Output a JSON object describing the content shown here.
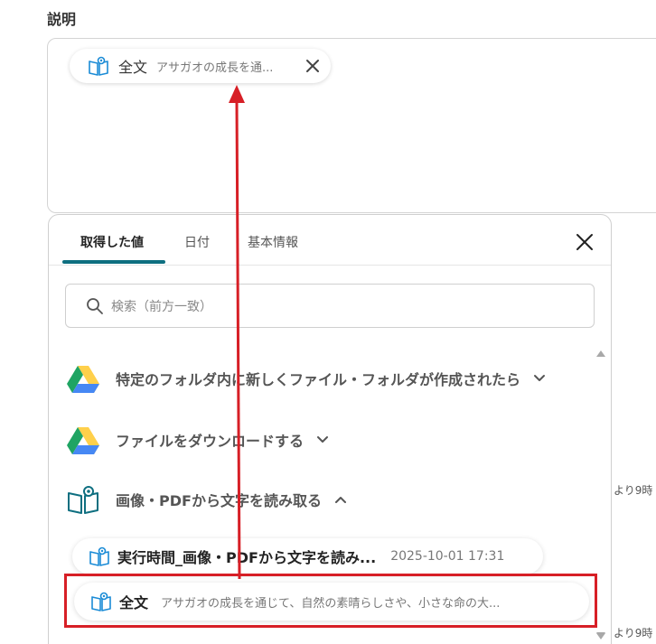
{
  "section": {
    "label": "説明"
  },
  "description_chip": {
    "title": "全文",
    "subtitle": "アサガオの成長を通..."
  },
  "panel": {
    "tabs": [
      {
        "label": "取得した値"
      },
      {
        "label": "日付"
      },
      {
        "label": "基本情報"
      }
    ],
    "active_tab": 0,
    "search": {
      "placeholder": "検索（前方一致）"
    },
    "rows": [
      {
        "label": "特定のフォルダ内に新しくファイル・フォルダが作成されたら",
        "icon": "google-drive-icon",
        "expanded": false
      },
      {
        "label": "ファイルをダウンロードする",
        "icon": "google-drive-icon",
        "expanded": false
      },
      {
        "label": "画像・PDFから文字を読み取る",
        "icon": "ocr-book-icon",
        "expanded": true
      }
    ],
    "sub_items": [
      {
        "title": "実行時間_画像・PDFから文字を読み...",
        "meta": "2025-10-01 17:31"
      },
      {
        "title": "全文",
        "text": "アサガオの成長を通じて、自然の素晴らしさや、小さな命の大..."
      }
    ]
  },
  "side_notes": [
    "より9時",
    "より9時"
  ],
  "colors": {
    "accent": "#0e6f80",
    "highlight": "#d71f26",
    "drive_green": "#1fa463",
    "drive_yellow": "#ffd04b",
    "drive_blue": "#4688f4"
  }
}
